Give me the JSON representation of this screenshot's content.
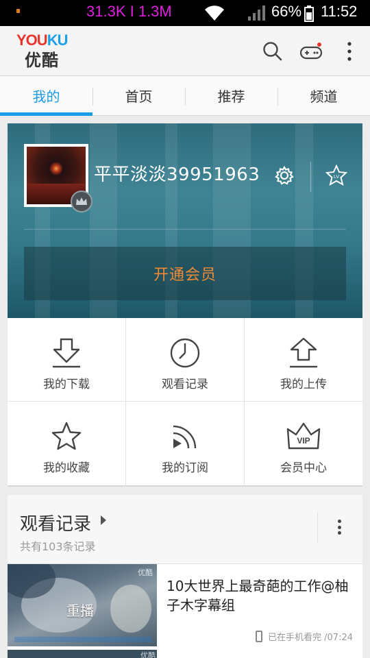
{
  "status_bar": {
    "network_speed": "31.3K I 1.3M",
    "battery": "66%",
    "time": "11:52"
  },
  "app_bar": {
    "logo_en_you": "YOU",
    "logo_en_ku": "KU",
    "logo_cn": "优酷",
    "icons": [
      "search-icon",
      "gamepad-icon",
      "more-vert-icon"
    ]
  },
  "tabs": [
    {
      "label": "我的",
      "active": true
    },
    {
      "label": "首页",
      "active": false
    },
    {
      "label": "推荐",
      "active": false
    },
    {
      "label": "频道",
      "active": false
    }
  ],
  "profile": {
    "username": "平平淡淡39951963",
    "lv_badge": "LV",
    "vip_button": "开通会员"
  },
  "grid": [
    {
      "label": "我的下载",
      "icon": "download-icon"
    },
    {
      "label": "观看记录",
      "icon": "clock-icon"
    },
    {
      "label": "我的上传",
      "icon": "upload-icon"
    },
    {
      "label": "我的收藏",
      "icon": "star-icon"
    },
    {
      "label": "我的订阅",
      "icon": "rss-icon"
    },
    {
      "label": "会员中心",
      "icon": "vip-crown-icon"
    }
  ],
  "grid_vip_text": "VIP",
  "history": {
    "title": "观看记录",
    "subtitle": "共有103条记录",
    "items": [
      {
        "title": "10大世界上最奇葩的工作@柚子木字幕组",
        "thumb_overlay": "重播",
        "thumb_logo": "优酷",
        "meta": "已在手机看完 /07:24"
      }
    ],
    "next_thumb_logo": "优酷"
  },
  "colors": {
    "accent": "#1a9be6",
    "vip_orange": "#f08a35",
    "net_speed": "#e020e0"
  }
}
